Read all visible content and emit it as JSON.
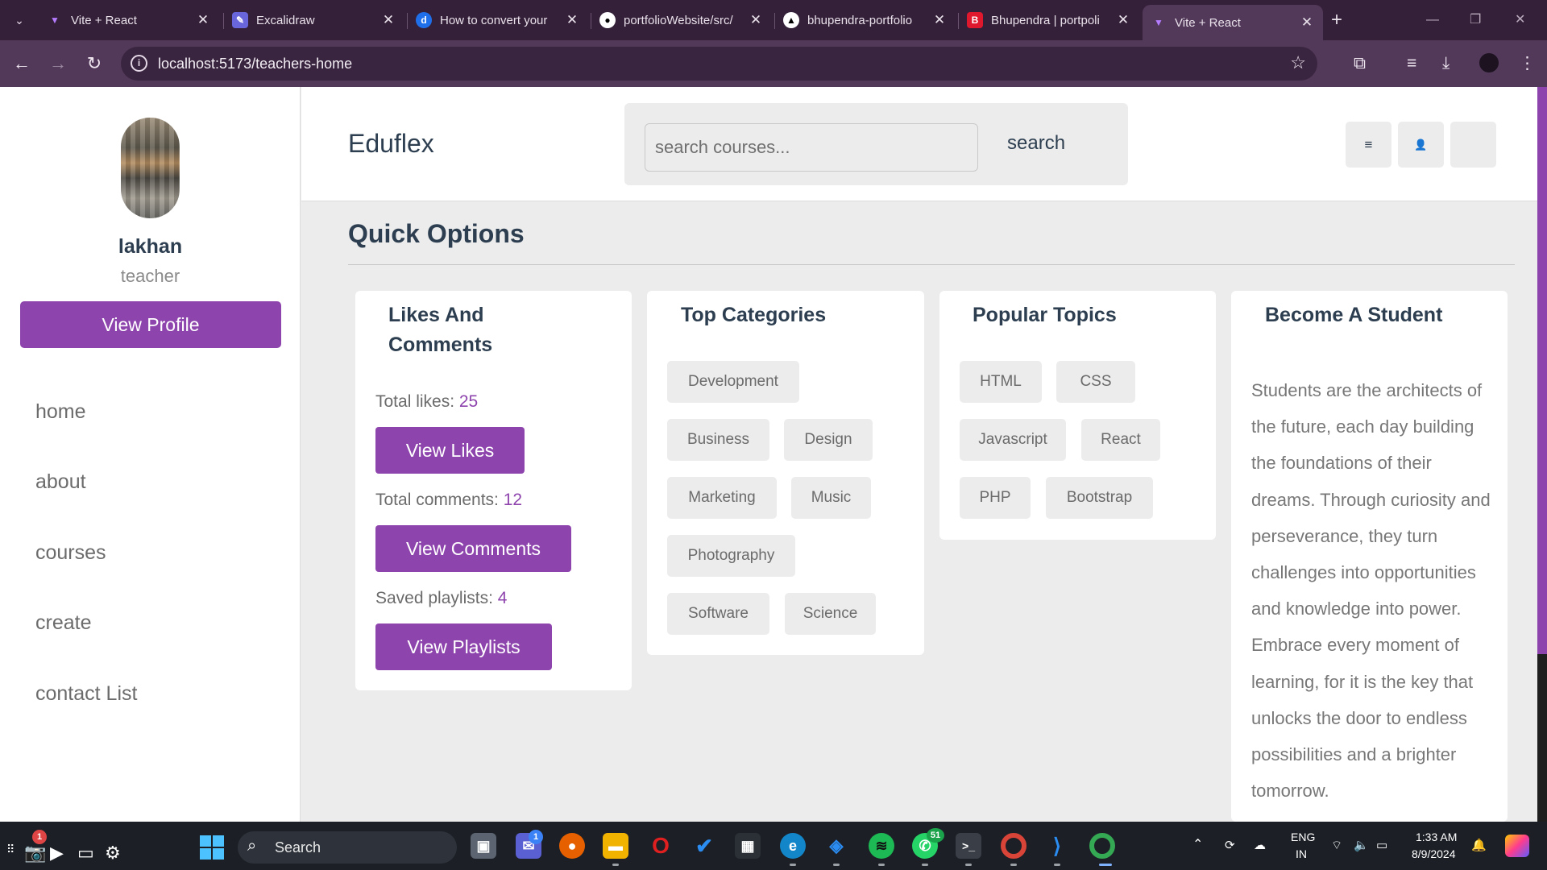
{
  "browser": {
    "tabs": [
      {
        "title": "Vite + React",
        "favicon": "vite-icon",
        "color": "#9b6bff"
      },
      {
        "title": "Excalidraw",
        "favicon": "excalidraw-icon",
        "color": "#6965db"
      },
      {
        "title": "How to convert your",
        "favicon": "d-icon",
        "color": "#1f6feb"
      },
      {
        "title": "portfolioWebsite/src/",
        "favicon": "github-icon",
        "color": "#ffffff"
      },
      {
        "title": "bhupendra-portfolio",
        "favicon": "vercel-icon",
        "color": "#ffffff"
      },
      {
        "title": "Bhupendra | portpoli",
        "favicon": "b-icon",
        "color": "#e0182d"
      },
      {
        "title": "Vite + React",
        "favicon": "vite-icon",
        "color": "#9b6bff",
        "active": true
      }
    ],
    "url": "localhost:5173/teachers-home",
    "accent": "#52395a"
  },
  "sidebar": {
    "name": "lakhan",
    "role": "teacher",
    "view_profile": "View Profile",
    "links": [
      "home",
      "about",
      "courses",
      "create",
      "contact List"
    ]
  },
  "header": {
    "logo": "Eduflex",
    "search_placeholder": "search courses...",
    "search_label": "search",
    "menu_icon": "≡",
    "user_icon": "👤"
  },
  "main": {
    "section_title": "Quick Options",
    "likes_card": {
      "title": "Likes And Comments",
      "likes_label": "Total likes: ",
      "likes_value": "25",
      "view_likes": "View Likes",
      "comments_label": "Total comments: ",
      "comments_value": "12",
      "view_comments": "View Comments",
      "playlists_label": "Saved playlists: ",
      "playlists_value": "4",
      "view_playlists": "View Playlists"
    },
    "categories_card": {
      "title": "Top Categories",
      "chips": [
        "Development",
        "Business",
        "Design",
        "Marketing",
        "Music",
        "Photography",
        "Software",
        "Science"
      ]
    },
    "topics_card": {
      "title": "Popular Topics",
      "chips": [
        "HTML",
        "CSS",
        "Javascript",
        "React",
        "PHP",
        "Bootstrap"
      ]
    },
    "student_card": {
      "title": "Become A Student",
      "text": "Students are the architects of the future, each day building the foundations of their dreams. Through curiosity and perseverance, they turn challenges into opportunities and knowledge into power. Embrace every moment of learning, for it is the key that unlocks the door to endless possibilities and a brighter tomorrow."
    },
    "brand_color": "#8e44ad"
  },
  "taskbar": {
    "search_label": "Search",
    "lang": "ENG",
    "region": "IN",
    "time": "1:33 AM",
    "date": "8/9/2024",
    "camera_badge": "1",
    "chat_badge": "1",
    "whatsapp_badge": "51"
  }
}
